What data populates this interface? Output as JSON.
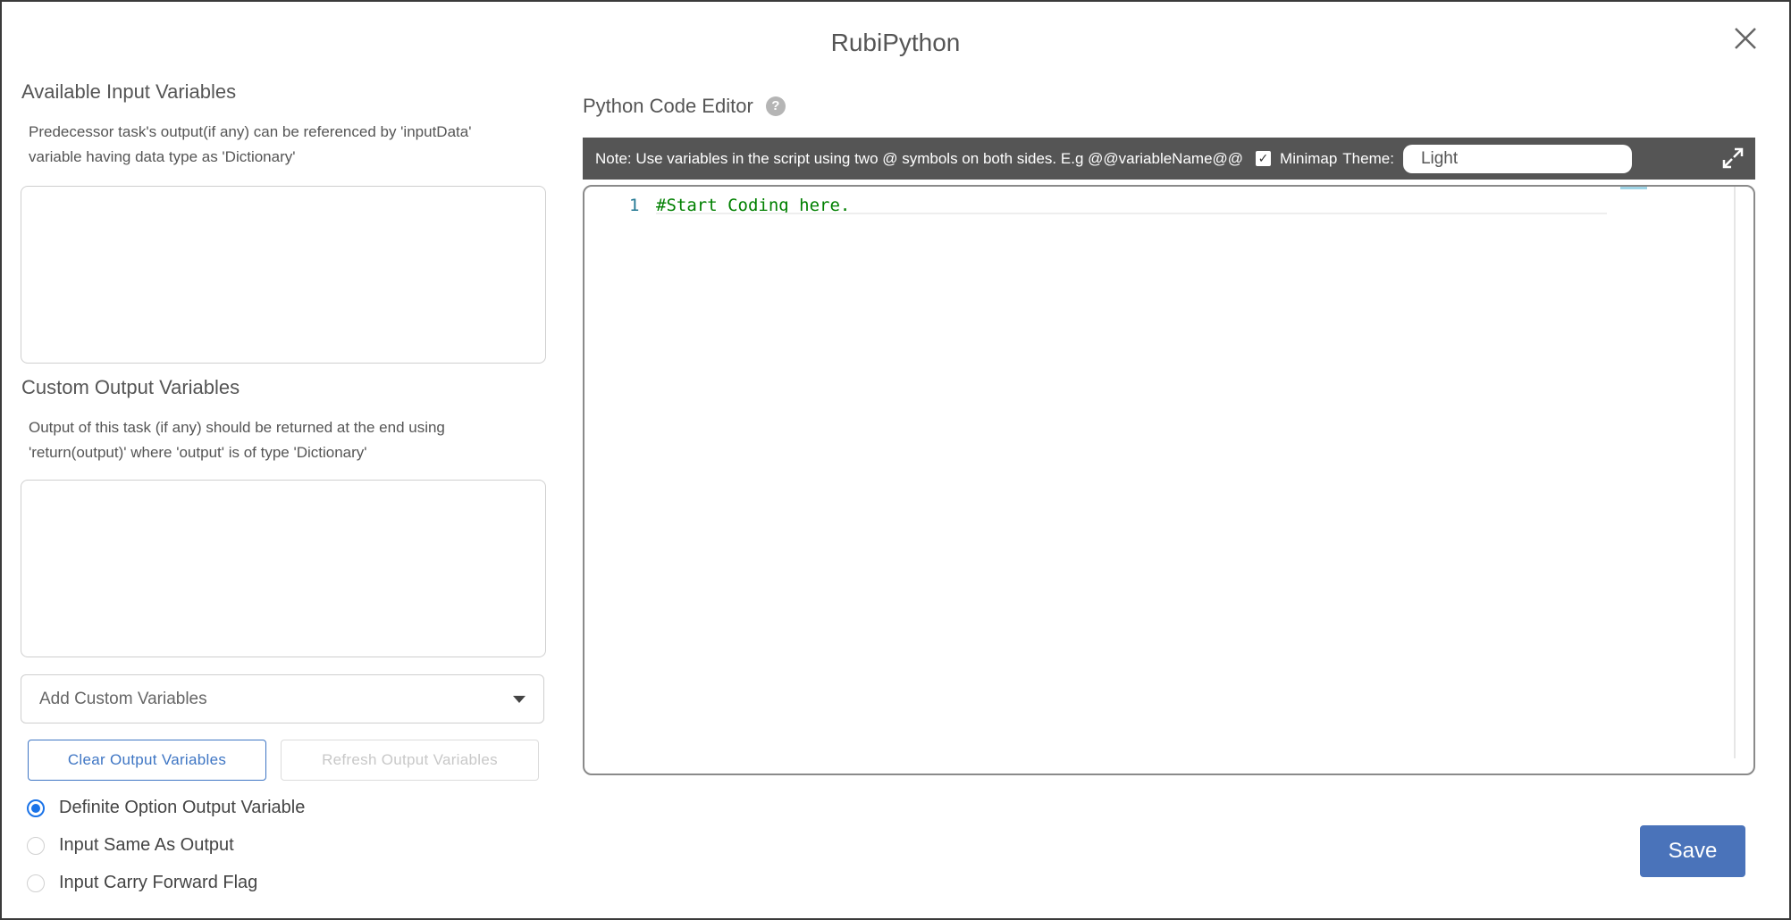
{
  "dialog": {
    "title": "RubiPython"
  },
  "left": {
    "input_section": {
      "title": "Available Input Variables",
      "description_line1": "Predecessor task's output(if any) can be referenced by 'inputData'",
      "description_line2": "variable having data type as 'Dictionary'"
    },
    "output_section": {
      "title": "Custom Output Variables",
      "description_line1": "Output of this task (if any) should be returned at the end using",
      "description_line2": "'return(output)' where 'output' is of type 'Dictionary'"
    },
    "add_custom_variables": {
      "label": "Add Custom Variables",
      "icon": "caret-down-icon"
    },
    "buttons": {
      "clear": "Clear Output Variables",
      "refresh": "Refresh Output Variables"
    },
    "options": [
      {
        "label": "Definite Option Output Variable",
        "checked": true
      },
      {
        "label": "Input Same As Output",
        "checked": false
      },
      {
        "label": "Input Carry Forward Flag",
        "checked": false
      }
    ]
  },
  "editor": {
    "heading": "Python Code Editor",
    "help_icon": "?",
    "toolbar": {
      "note": "Note: Use variables in the script using two @ symbols on both sides. E.g @@variableName@@",
      "minimap_checked": true,
      "minimap_label": "Minimap",
      "theme_label": "Theme:",
      "theme_value": "Light"
    },
    "lines": [
      {
        "number": "1",
        "text": "#Start Coding here."
      }
    ]
  },
  "actions": {
    "save": "Save"
  },
  "colors": {
    "accent": "#3f76c4",
    "save_button": "#4a73ba",
    "toolbar_bg": "#555555",
    "comment_green": "#008000",
    "line_number": "#237893"
  }
}
